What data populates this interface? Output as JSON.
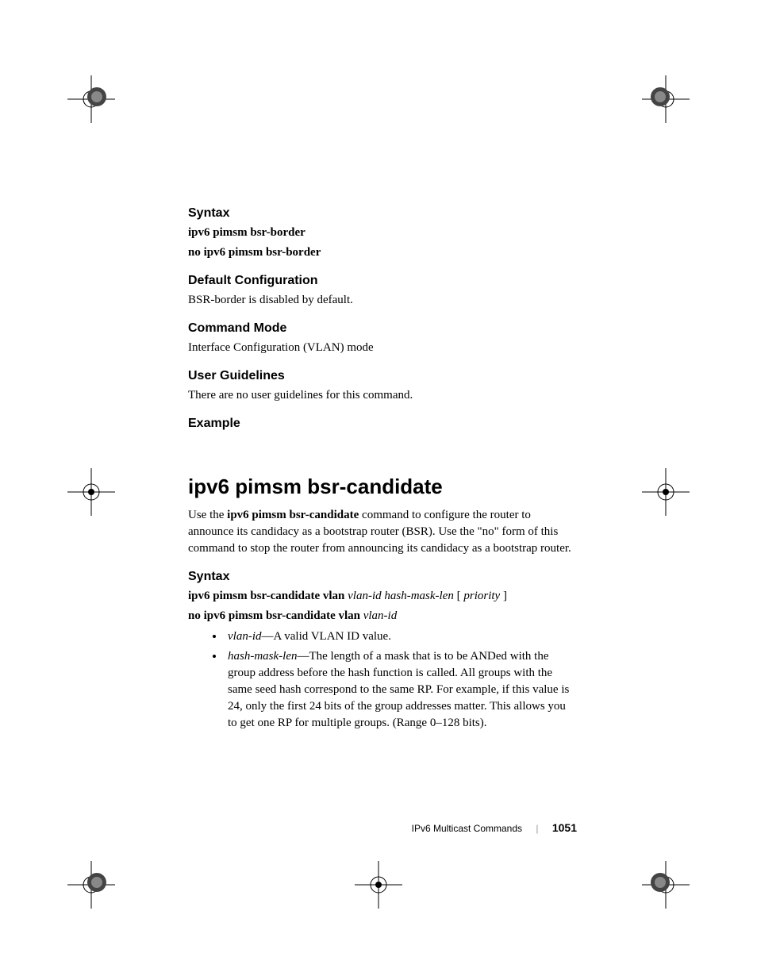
{
  "section1": {
    "syntax_heading": "Syntax",
    "syntax_line1": "ipv6 pimsm bsr-border",
    "syntax_line2": "no ipv6 pimsm bsr-border",
    "default_config_heading": "Default Configuration",
    "default_config_text": "BSR-border is disabled by default.",
    "command_mode_heading": "Command Mode",
    "command_mode_text": "Interface Configuration (VLAN) mode",
    "user_guidelines_heading": "User Guidelines",
    "user_guidelines_text": "There are no user guidelines for this command.",
    "example_heading": "Example"
  },
  "section2": {
    "title": "ipv6 pimsm bsr-candidate",
    "intro_prefix": "Use the ",
    "intro_cmd": "ipv6 pimsm bsr-candidate",
    "intro_suffix": " command to configure the router to announce its candidacy as a bootstrap router (BSR). Use the \"no\" form of this command to stop the router from announcing its candidacy as a bootstrap router.",
    "syntax_heading": "Syntax",
    "syntax1_bold": "ipv6 pimsm bsr-candidate vlan ",
    "syntax1_italic1": "vlan-id hash-mask-len",
    "syntax1_bracket_open": " [ ",
    "syntax1_italic2": "priority",
    "syntax1_bracket_close": " ]",
    "syntax2_bold": "no ipv6 pimsm bsr-candidate vlan ",
    "syntax2_italic": "vlan-id",
    "bullet1_term": "vlan-id",
    "bullet1_text": "—A valid VLAN ID value.",
    "bullet2_term": "hash-mask-len",
    "bullet2_text": "—The length of a mask that is to be ANDed with the group address before the hash function is called. All groups with the same seed hash correspond to the same RP. For example, if this value is 24, only the first 24 bits of the group addresses matter. This allows you to get one RP for multiple groups. (Range 0–128 bits)."
  },
  "footer": {
    "chapter": "IPv6 Multicast Commands",
    "page": "1051"
  }
}
